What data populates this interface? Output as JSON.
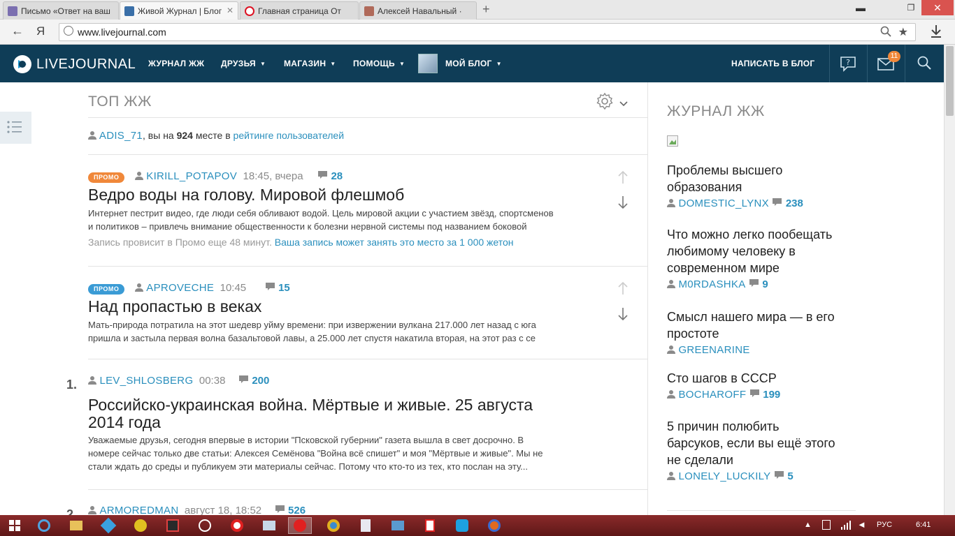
{
  "browser": {
    "tabs": [
      {
        "title": "Письмо «Ответ на ваш",
        "active": false
      },
      {
        "title": "Живой Журнал | Блог",
        "active": true
      },
      {
        "title": "Главная страница От",
        "active": false
      },
      {
        "title": "Алексей Навальный ·",
        "active": false
      }
    ],
    "back_label": "←",
    "yandex_label": "Я",
    "url": "www.livejournal.com",
    "new_tab": "+",
    "win_min": "▬",
    "win_max": "❐",
    "win_close": "✕"
  },
  "header": {
    "logo_text": "LIVEJOURNAL",
    "nav": [
      {
        "label": "ЖУРНАЛ ЖЖ",
        "dropdown": false
      },
      {
        "label": "ДРУЗЬЯ",
        "dropdown": true
      },
      {
        "label": "МАГАЗИН",
        "dropdown": true
      },
      {
        "label": "ПОМОЩЬ",
        "dropdown": true
      },
      {
        "label": "МОЙ БЛОГ",
        "dropdown": true
      }
    ],
    "write_label": "НАПИСАТЬ В БЛОГ",
    "mail_badge": "11"
  },
  "top": {
    "heading": "ТОП ЖЖ",
    "rating": {
      "user": "ADIS_71",
      "text_before": ", вы на ",
      "place": "924",
      "text_after": " месте в ",
      "link": "рейтинге пользователей"
    },
    "promo_posts": [
      {
        "badge": "ПРОМО",
        "badge_color": "#f0883a",
        "user": "KIRILL_POTAPOV",
        "time": "18:45, вчера",
        "comments": "28",
        "title": "Ведро воды на голову. Мировой флешмоб",
        "excerpt1": "Интернет пестрит видео, где люди себя обливают водой. Цель мировой акции с участием звёзд, спортсменов",
        "excerpt2": "и политиков – привлечь внимание общественности к болезни нервной системы под названием боковой",
        "promo_note": "Запись провисит в Промо еще 48 минут.",
        "promo_link": "Ваша запись может занять это место за 1 000 жетон"
      },
      {
        "badge": "ПРОМО",
        "badge_color": "#3a9bd5",
        "user": "APROVECHE",
        "time": "10:45",
        "comments": "15",
        "title": "Над пропастью в веках",
        "excerpt1": "Мать-природа потратила на этот шедевр уйму времени: при извержении вулкана 217.000 лет назад с юга",
        "excerpt2": "пришла и застыла первая волна базальтовой лавы, а 25.000 лет спустя накатила вторая, на этот раз с се"
      }
    ],
    "ranked_posts": [
      {
        "rank": "1.",
        "user": "LEV_SHLOSBERG",
        "time": "00:38",
        "comments": "200",
        "title1": "Российско-украинская война. Мёртвые и живые. 25 августа",
        "title2": "2014 года",
        "excerpt1": "Уважаемые друзья, сегодня впервые в истории \"Псковской губернии\" газета вышла в свет досрочно. В",
        "excerpt2": "номере сейчас только две статьи: Алексея Семёнова \"Война всё спишет\" и моя \"Мёртвые и живые\". Мы не",
        "excerpt3": "стали ждать до среды и публикуем эти материалы сейчас. Потому что кто-то из тех, кто послан на эту..."
      },
      {
        "rank": "2.",
        "user": "ARMOREDMAN",
        "time": "август 18, 18:52",
        "comments": "526"
      }
    ]
  },
  "sidebar": {
    "heading": "ЖУРНАЛ ЖЖ",
    "items": [
      {
        "title1": "Проблемы высшего",
        "title2": "образования",
        "title3": "",
        "user": "DOMESTIC_LYNX",
        "comments": "238"
      },
      {
        "title1": "Что можно легко пообещать",
        "title2": "любимому человеку в",
        "title3": "современном мире",
        "user": "M0RDASHKA",
        "comments": "9"
      },
      {
        "title1": "Смысл нашего мира — в его",
        "title2": "простоте",
        "title3": "",
        "user": "GREENARINE",
        "comments": ""
      },
      {
        "title1": "Сто шагов в СССР",
        "title2": "",
        "title3": "",
        "user": "BOCHAROFF",
        "comments": "199"
      },
      {
        "title1": "5 причин полюбить",
        "title2": "барсуков, если вы ещё этого",
        "title3": "не сделали",
        "user": "LONELY_LUCKILY",
        "comments": "5"
      }
    ]
  },
  "taskbar": {
    "lang": "РУС",
    "clock": "6:41"
  }
}
